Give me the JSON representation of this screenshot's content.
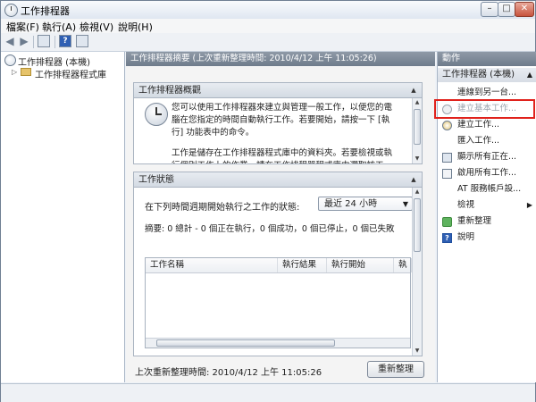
{
  "window": {
    "title": "工作排程器"
  },
  "menu": [
    "檔案(F)",
    "執行(A)",
    "檢視(V)",
    "說明(H)"
  ],
  "icons": {
    "app": "clock-icon",
    "back": "back-arrow-icon",
    "forward": "forward-arrow-icon",
    "toolbar": [
      "show-tree-icon",
      "help-icon",
      "show-actions-icon"
    ]
  },
  "tree": {
    "root": "工作排程器 (本機)",
    "child": "工作排程器程式庫"
  },
  "center": {
    "header": "工作排程器摘要 (上次重新整理時間: 2010/4/12 上午 11:05:26)",
    "overview": {
      "title": "工作排程器概觀",
      "paragraph1": "您可以使用工作排程器來建立與管理一般工作，以便您的電腦在您指定的時間自動執行工作。若要開始，請按一下 [執行] 功能表中的命令。",
      "paragraph2": "工作是儲存在工作排程器程式庫中的資料夾。若要檢視或執行個別工作上的作業，請在工作排程器程式庫中選取該工作，然"
    },
    "status": {
      "title": "工作狀態",
      "label": "在下列時間週期開始執行之工作的狀態:",
      "period": "最近 24 小時",
      "summary": "摘要: 0 總計 - 0 個正在執行，0 個成功，0 個已停止，0 個已失敗",
      "columns": [
        "工作名稱",
        "執行結果",
        "執行開始",
        "執"
      ]
    },
    "last_refresh": "上次重新整理時間: 2010/4/12 上午 11:05:26",
    "refresh_button": "重新整理"
  },
  "actions": {
    "header": "動作",
    "group": "工作排程器 (本機)",
    "items": [
      {
        "label": "連線到另一台...",
        "icon": "blank",
        "enabled": true
      },
      {
        "label": "建立基本工作...",
        "icon": "wizard-icon",
        "enabled": false
      },
      {
        "label": "建立工作...",
        "icon": "create-task-icon",
        "enabled": true
      },
      {
        "label": "匯入工作...",
        "icon": "blank",
        "enabled": true
      },
      {
        "label": "顯示所有正在...",
        "icon": "running-tasks-icon",
        "enabled": true
      },
      {
        "label": "啟用所有工作...",
        "icon": "history-icon",
        "enabled": true
      },
      {
        "label": "AT 服務帳戶設...",
        "icon": "blank",
        "enabled": true
      },
      {
        "label": "檢視",
        "icon": "blank",
        "enabled": true
      },
      {
        "label": "重新整理",
        "icon": "refresh-icon",
        "enabled": true
      },
      {
        "label": "說明",
        "icon": "help-icon",
        "enabled": true
      }
    ]
  },
  "colors": {
    "highlight": "#e0221c",
    "pane_header": "#7b8796"
  }
}
